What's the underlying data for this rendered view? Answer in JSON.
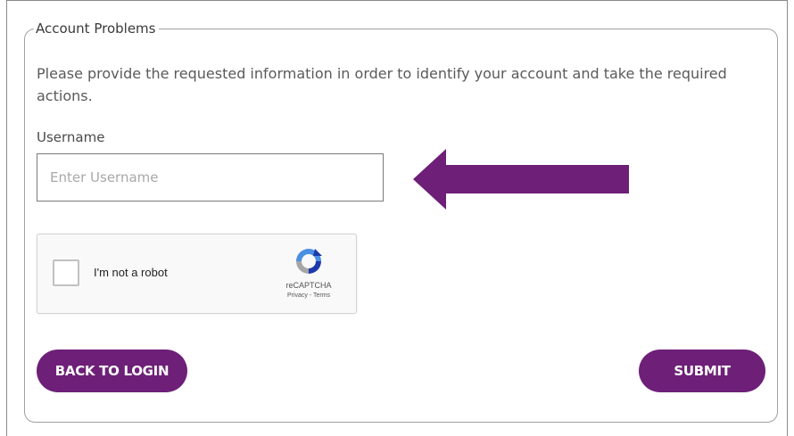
{
  "form": {
    "legend": "Account Problems",
    "description": "Please provide the requested information in order to identify your account and take the required actions.",
    "username": {
      "label": "Username",
      "placeholder": "Enter Username",
      "value": ""
    }
  },
  "captcha": {
    "label": "I'm not a robot",
    "brand": "reCAPTCHA",
    "links": "Privacy - Terms",
    "checked": false
  },
  "actions": {
    "back_label": "BACK TO LOGIN",
    "submit_label": "SUBMIT"
  },
  "colors": {
    "accent": "#6e1f78",
    "arrow": "#6e1f78"
  },
  "icons": {
    "annotation": "left-arrow-icon",
    "captcha": "recaptcha-logo-icon"
  }
}
